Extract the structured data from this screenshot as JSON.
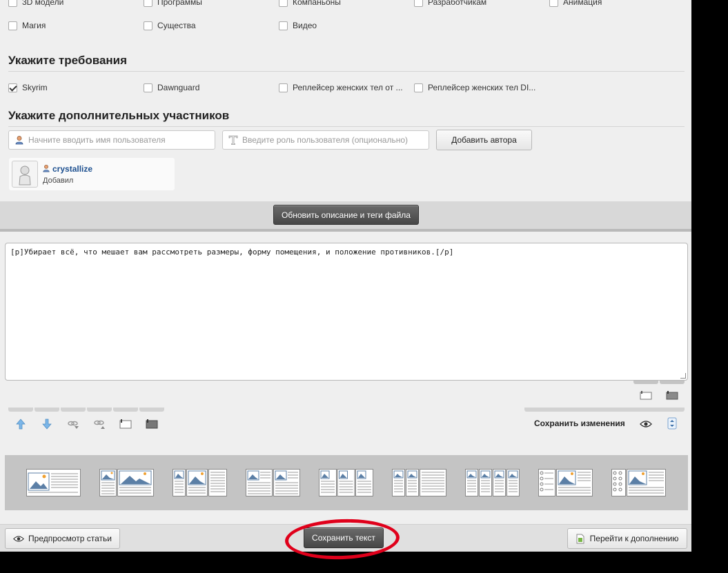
{
  "categories_row1": [
    "3D модели",
    "Программы",
    "Компаньоны",
    "Разработчикам",
    "Анимация"
  ],
  "categories_row2": [
    "Магия",
    "Существа",
    "Видео"
  ],
  "requirements": {
    "title": "Укажите требования",
    "items": [
      {
        "label": "Skyrim",
        "checked": true
      },
      {
        "label": "Dawnguard",
        "checked": false
      },
      {
        "label": "Реплейсер женских тел от ...",
        "checked": false
      },
      {
        "label": "Реплейсер женских тел DI...",
        "checked": false
      }
    ]
  },
  "participants": {
    "title": "Укажите дополнительных участников",
    "user_placeholder": "Начните вводить имя пользователя",
    "role_placeholder": "Введите роль пользователя (опционально)",
    "add_button": "Добавить автора",
    "author": {
      "name": "crystallize",
      "role": "Добавил"
    }
  },
  "update_button": "Обновить описание и теги файла",
  "editor": {
    "content": "[p]Убирает всё, что мешает вам рассмотреть размеры, форму помещения, и положение противников.[/p]"
  },
  "toolbar": {
    "save_changes": "Сохранить изменения"
  },
  "footer": {
    "preview_button": "Предпросмотр статьи",
    "save_text_button": "Сохранить текст",
    "go_to_addon_button": "Перейти к дополнению"
  },
  "colors": {
    "annotation": "#e0001b",
    "link": "#1c4f8f"
  }
}
